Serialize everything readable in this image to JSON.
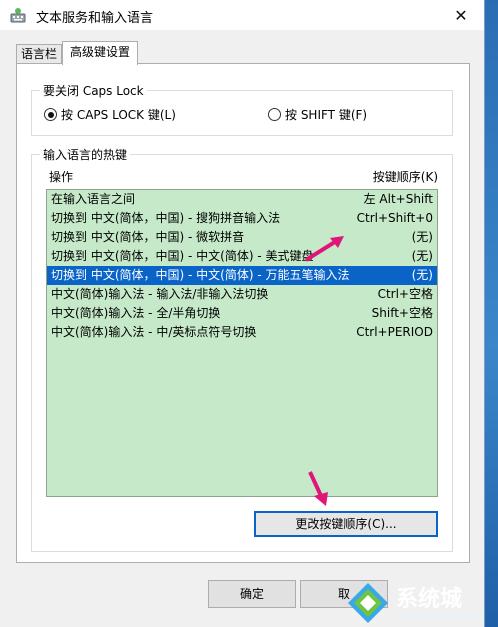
{
  "window": {
    "title": "文本服务和输入语言",
    "close_label": "✕"
  },
  "tabs": [
    {
      "label": "语言栏",
      "active": false
    },
    {
      "label": "高级键设置",
      "active": true
    }
  ],
  "caps_lock": {
    "legend": "要关闭 Caps Lock",
    "options": [
      {
        "label": "按 CAPS LOCK 键(L)",
        "selected": true
      },
      {
        "label": "按 SHIFT 键(F)",
        "selected": false
      }
    ]
  },
  "hotkeys": {
    "legend": "输入语言的热键",
    "col_action": "操作",
    "col_keys": "按键顺序(K)",
    "rows": [
      {
        "action": "在输入语言之间",
        "keys": "左 Alt+Shift",
        "selected": false
      },
      {
        "action": "切换到 中文(简体，中国) - 搜狗拼音输入法",
        "keys": "Ctrl+Shift+0",
        "selected": false
      },
      {
        "action": "切换到 中文(简体，中国) - 微软拼音",
        "keys": "(无)",
        "selected": false
      },
      {
        "action": "切换到 中文(简体，中国) - 中文(简体) - 美式键盘",
        "keys": "(无)",
        "selected": false
      },
      {
        "action": "切换到 中文(简体，中国) - 中文(简体) - 万能五笔输入法",
        "keys": "(无)",
        "selected": true
      },
      {
        "action": "中文(简体)输入法 - 输入法/非输入法切换",
        "keys": "Ctrl+空格",
        "selected": false
      },
      {
        "action": "中文(简体)输入法 - 全/半角切换",
        "keys": "Shift+空格",
        "selected": false
      },
      {
        "action": "中文(简体)输入法 - 中/英标点符号切换",
        "keys": "Ctrl+PERIOD",
        "selected": false
      }
    ],
    "change_button": "更改按键顺序(C)..."
  },
  "buttons": {
    "ok": "确定",
    "cancel": "取"
  },
  "watermark": {
    "text": "系统城",
    "url": "xitongcheng.com"
  },
  "colors": {
    "list_bg": "#c6eac9",
    "selection": "#0a64c8",
    "arrow": "#e0157a"
  }
}
